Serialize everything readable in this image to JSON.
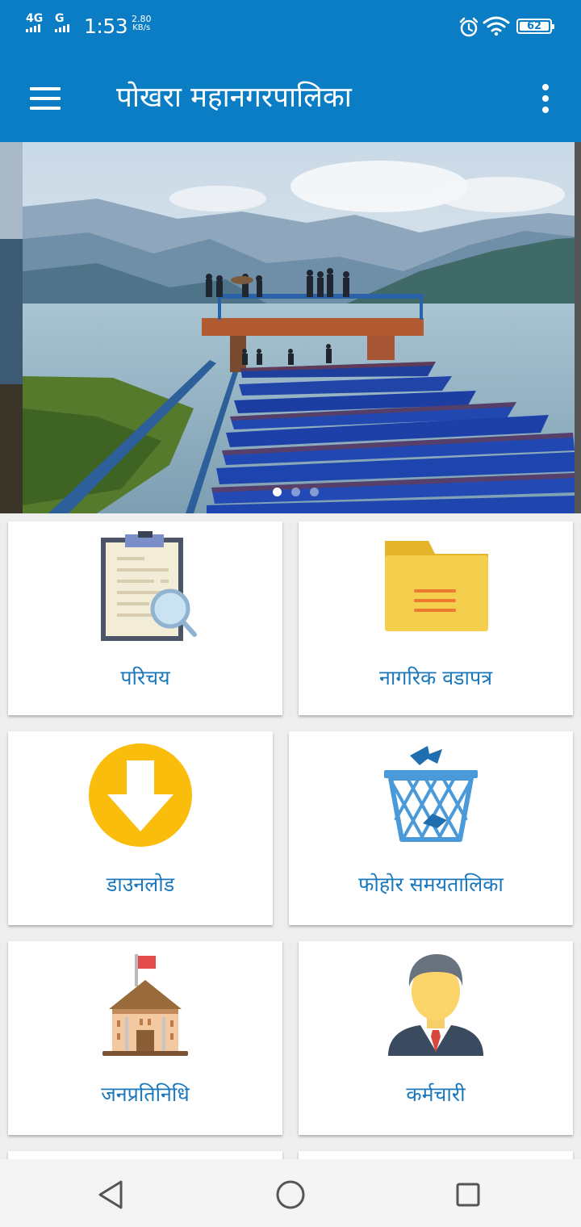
{
  "status_bar": {
    "network_1": "4G",
    "network_2": "G",
    "time": "1:53",
    "speed_value": "2.80",
    "speed_unit": "KB/s",
    "battery": "62"
  },
  "app_bar": {
    "title": "पोखरा महानगरपालिका",
    "menu_icon": "hamburger-menu-icon",
    "more_icon": "more-vertical-icon"
  },
  "banner": {
    "slides_count": 3,
    "active_slide": 1
  },
  "tiles": [
    {
      "label": "परिचय",
      "icon": "clipboard-search-icon"
    },
    {
      "label": "नागरिक वडापत्र",
      "icon": "folder-icon"
    },
    {
      "label": "डाउनलोड",
      "icon": "download-icon"
    },
    {
      "label": "फोहोर समयतालिका",
      "icon": "trash-basket-icon"
    },
    {
      "label": "जनप्रतिनिधि",
      "icon": "government-building-icon"
    },
    {
      "label": "कर्मचारी",
      "icon": "employee-icon"
    }
  ],
  "colors": {
    "primary": "#0a7dc4",
    "tile_label": "#1b78bc"
  },
  "nav_bar": {
    "back_icon": "back-triangle-icon",
    "home_icon": "home-circle-icon",
    "recents_icon": "recents-square-icon"
  }
}
